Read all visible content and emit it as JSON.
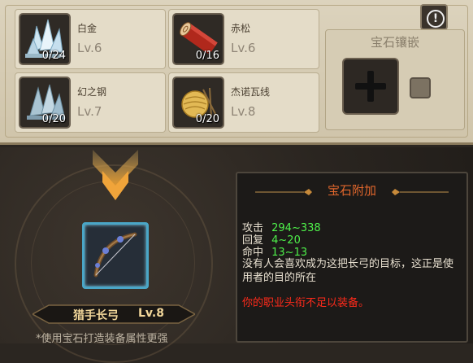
{
  "materials": [
    {
      "name": "白金",
      "level": "Lv.6",
      "count": "0/24",
      "icon": "platinum-crystal-icon"
    },
    {
      "name": "赤松",
      "level": "Lv.6",
      "count": "0/16",
      "icon": "red-pine-log-icon"
    },
    {
      "name": "幻之钢",
      "level": "Lv.7",
      "count": "0/20",
      "icon": "phantom-steel-crystal-icon"
    },
    {
      "name": "杰诺瓦线",
      "level": "Lv.8",
      "count": "0/20",
      "icon": "jenova-thread-spool-icon"
    }
  ],
  "info_button": {
    "label": "!"
  },
  "gem_inlay": {
    "title": "宝石镶嵌"
  },
  "weapon": {
    "name": "猎手长弓",
    "level": "Lv.8",
    "icon": "longbow-icon"
  },
  "hint": "*使用宝石打造装备属性更强",
  "tooltip": {
    "title": "宝石附加",
    "stats": [
      {
        "label": "攻击",
        "value": "294~338"
      },
      {
        "label": "回复",
        "value": "4~20"
      },
      {
        "label": "命中",
        "value": "13~13"
      }
    ],
    "description": "没有人会喜欢成为这把长弓的目标，这正是使用者的目的所在",
    "warning": "你的职业头衔不足以装备。"
  },
  "colors": {
    "stat_value": "#4ef04a",
    "warning": "#ff2a1a",
    "tooltip_title": "#e0662c",
    "weapon_frame": "#4aa6c7"
  }
}
